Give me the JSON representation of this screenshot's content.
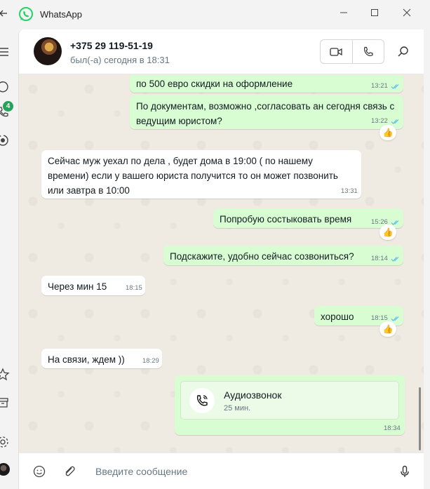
{
  "app": {
    "title": "WhatsApp",
    "unread_badge": "4"
  },
  "contact": {
    "name": "+375 29 119-51-19",
    "status": "был(-а) сегодня в 18:31"
  },
  "messages": [
    {
      "dir": "out",
      "text": "по 500 евро скидки на оформление",
      "time": "13:21",
      "read": true
    },
    {
      "dir": "out",
      "text": "По документам, возможно ,согласовать ан сегодня связь с ведущим юристом?",
      "time": "13:22",
      "read": true,
      "reaction": "👍"
    },
    {
      "dir": "in",
      "text": "Сейчас муж уехал по дела , будет дома в 19:00 ( по нашему времени) если у вашего юриста получится то он может позвонить или завтра в 10:00",
      "time": "13:31"
    },
    {
      "dir": "out",
      "text": "Попробую состыковать время",
      "time": "15:26",
      "read": true,
      "reaction": "👍"
    },
    {
      "dir": "out",
      "text": "Подскажите, удобно сейчас созвониться?",
      "time": "18:14",
      "read": true
    },
    {
      "dir": "in",
      "text": "Через мин 15",
      "time": "18:15"
    },
    {
      "dir": "out",
      "text": "хорошо",
      "time": "18:15",
      "read": true,
      "reaction": "👍"
    },
    {
      "dir": "in",
      "text": "На связи, ждем ))",
      "time": "18:29"
    }
  ],
  "call_message": {
    "title": "Аудиозвонок",
    "duration": "25 мин.",
    "time": "18:34"
  },
  "composer": {
    "placeholder": "Введите сообщение"
  },
  "colors": {
    "outgoing_bubble": "#d9fdd3",
    "incoming_bubble": "#ffffff",
    "read_ticks": "#53bdeb",
    "wallpaper": "#efeae2",
    "brand": "#25d366"
  }
}
